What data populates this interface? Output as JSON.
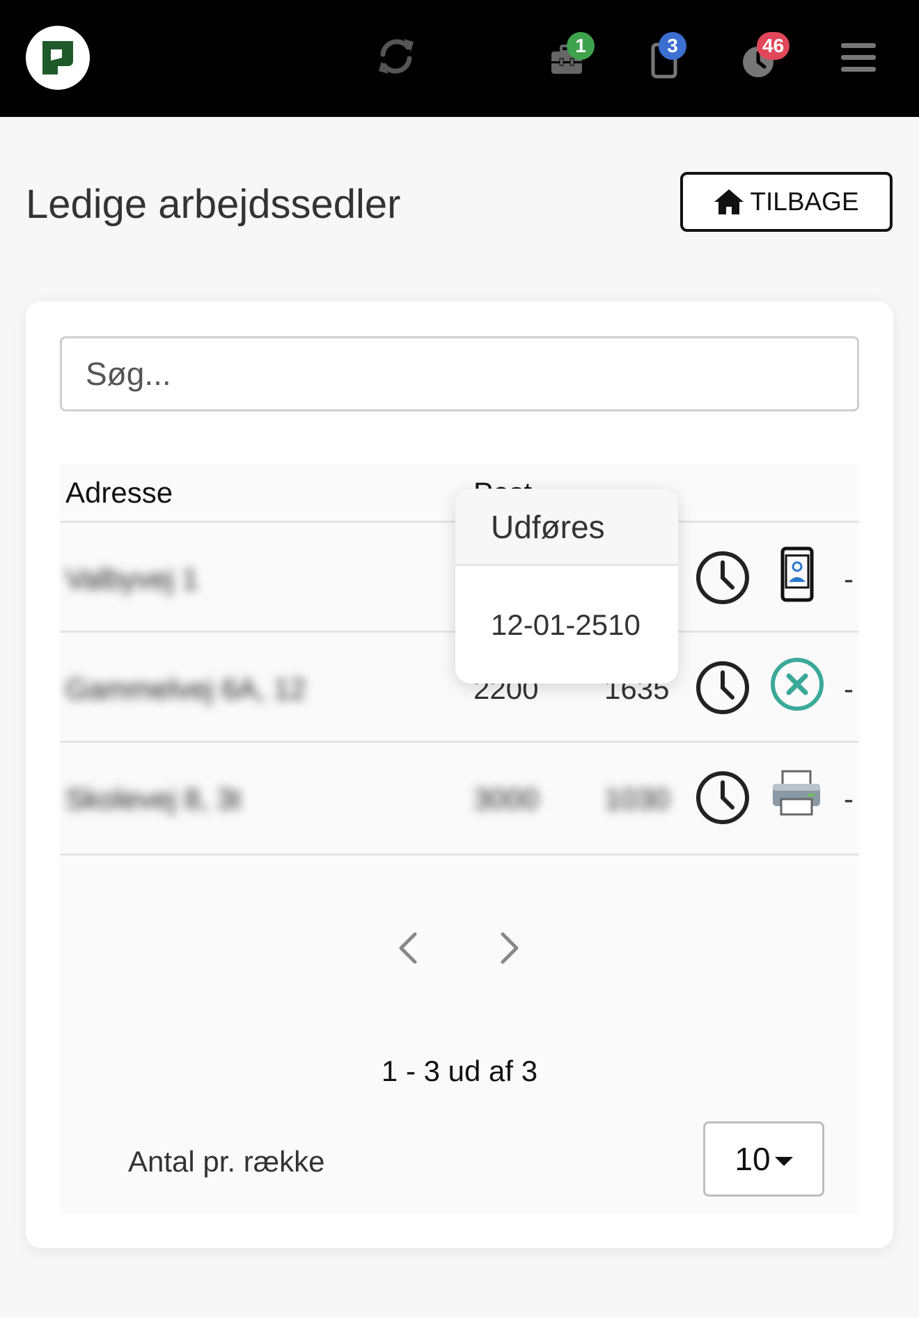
{
  "header": {
    "icons": [
      "logo-icon",
      "refresh-icon",
      "toolbox-icon",
      "phone-icon",
      "clock-icon",
      "menu-icon"
    ],
    "badges": {
      "toolbox": "1",
      "phone": "3",
      "clock": "46"
    },
    "badge_colors": {
      "toolbox": "#3fa34d",
      "phone": "#3b6fd1",
      "clock": "#e0475a"
    }
  },
  "page": {
    "title": "Ledige arbejdssedler",
    "back_label": "TILBAGE"
  },
  "search": {
    "placeholder": "Søg..."
  },
  "table": {
    "columns": [
      "Adresse",
      "Post"
    ],
    "rows": [
      {
        "address": "Valbyvej 1",
        "post": "",
        "number": "",
        "status_icon": "phone-person-icon"
      },
      {
        "address": "Gammelvej 6A, 12",
        "post": "2200",
        "number": "1635",
        "status_icon": "cancel-icon"
      },
      {
        "address": "Skolevej 8, 3t",
        "post": "3000",
        "number": "1030",
        "status_icon": "printer-icon"
      }
    ],
    "trailing": "-"
  },
  "popover": {
    "title": "Udføres",
    "value": "12-01-2510"
  },
  "pagination": {
    "range": "1 - 3 ud af 3",
    "per_row_label": "Antal pr. række",
    "per_row_value": "10"
  },
  "colors": {
    "accent_teal": "#3aa99a",
    "logo_green": "#1f5a2a"
  }
}
